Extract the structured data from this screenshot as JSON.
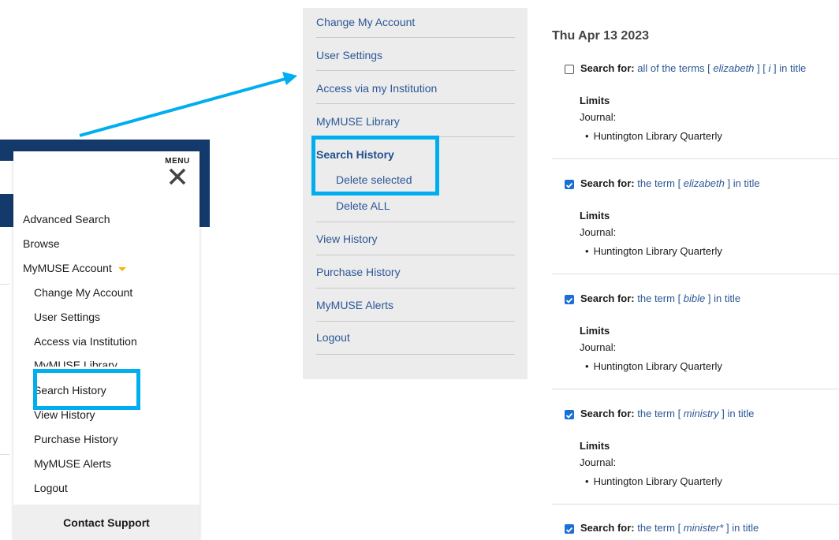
{
  "left_menu": {
    "menu_label": "MENU",
    "close_icon": "close-icon",
    "search_icon": "search-icon",
    "items": [
      {
        "label": "Advanced Search",
        "level": "top"
      },
      {
        "label": "Browse",
        "level": "top"
      },
      {
        "label": "MyMUSE Account",
        "level": "top",
        "has_caret": true
      },
      {
        "label": "Change My Account",
        "level": "sub"
      },
      {
        "label": "User Settings",
        "level": "sub"
      },
      {
        "label": "Access via Institution",
        "level": "sub"
      },
      {
        "label": "MyMUSE Library",
        "level": "sub"
      },
      {
        "label": "Search History",
        "level": "sub",
        "highlighted": true
      },
      {
        "label": "View History",
        "level": "sub"
      },
      {
        "label": "Purchase History",
        "level": "sub"
      },
      {
        "label": "MyMUSE Alerts",
        "level": "sub"
      },
      {
        "label": "Logout",
        "level": "sub"
      }
    ],
    "contact_support": "Contact Support"
  },
  "sidebar": {
    "items": [
      {
        "label": "Change My Account"
      },
      {
        "label": "User Settings"
      },
      {
        "label": "Access via my Institution"
      },
      {
        "label": "MyMUSE Library"
      },
      {
        "label": "Search History",
        "active": true
      },
      {
        "label": "Delete selected",
        "sub": true,
        "highlighted": true
      },
      {
        "label": "Delete ALL",
        "sub": true
      },
      {
        "label": "View History"
      },
      {
        "label": "Purchase History"
      },
      {
        "label": "MyMUSE Alerts"
      },
      {
        "label": "Logout"
      }
    ]
  },
  "history": {
    "date": "Thu Apr 13 2023",
    "search_for_label": "Search for:",
    "limits_label": "Limits",
    "journal_label": "Journal:",
    "entries": [
      {
        "checked": false,
        "prefix": "all of the terms",
        "terms": [
          "elizabeth",
          "i"
        ],
        "suffix": "in title",
        "journal": "Huntington Library Quarterly"
      },
      {
        "checked": true,
        "prefix": "the term",
        "terms": [
          "elizabeth"
        ],
        "suffix": "in title",
        "journal": "Huntington Library Quarterly"
      },
      {
        "checked": true,
        "prefix": "the term",
        "terms": [
          "bible"
        ],
        "suffix": "in title",
        "journal": "Huntington Library Quarterly"
      },
      {
        "checked": true,
        "prefix": "the term",
        "terms": [
          "ministry"
        ],
        "suffix": "in title",
        "journal": "Huntington Library Quarterly"
      },
      {
        "checked": true,
        "prefix": "the term",
        "terms": [
          "minister*"
        ],
        "suffix": "in title",
        "journal": ""
      }
    ]
  },
  "colors": {
    "header_navy": "#143a6b",
    "accent_yellow": "#f5b600",
    "highlight_cyan": "#00aeef",
    "link_blue": "#2b5797",
    "checkbox_blue": "#1a6fd6"
  }
}
